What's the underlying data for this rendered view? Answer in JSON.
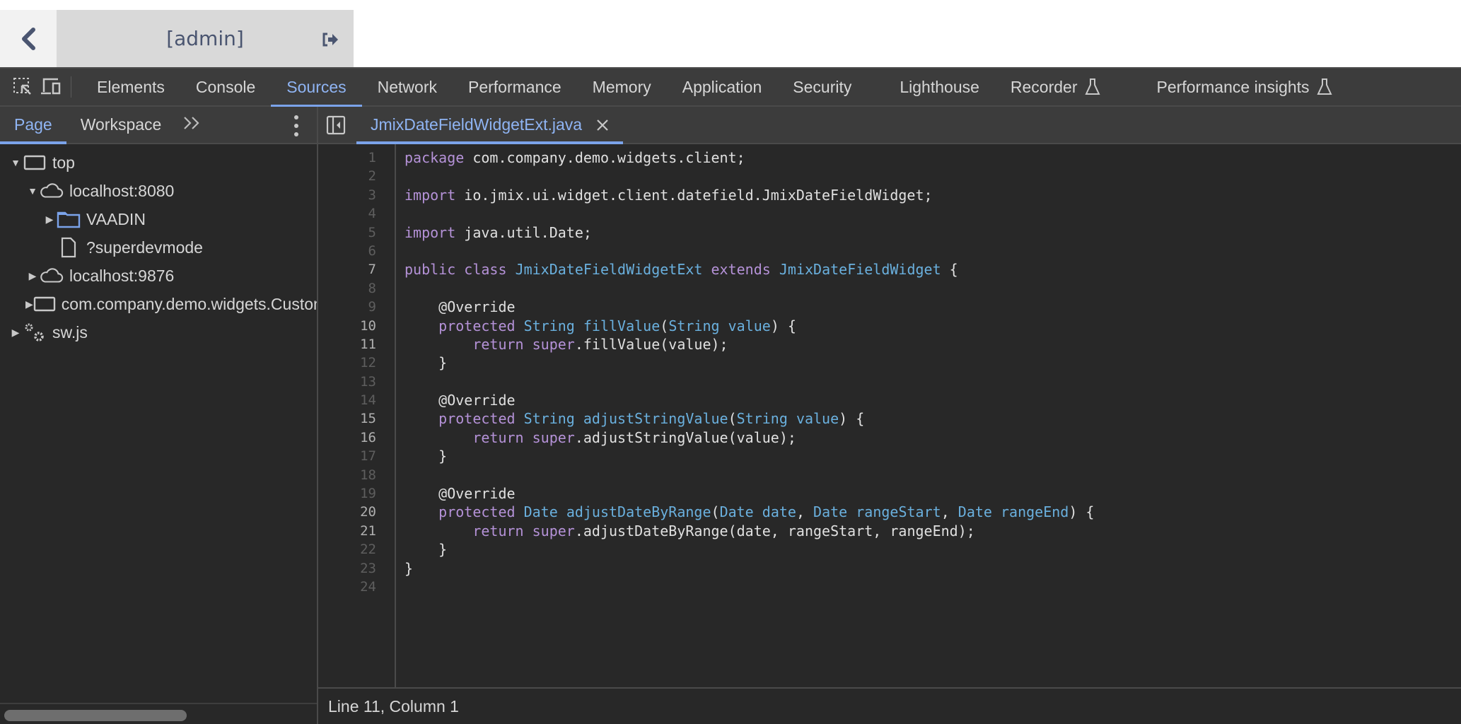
{
  "app_header": {
    "user_label": "[admin]"
  },
  "devtools": {
    "main_tabs": [
      {
        "label": "Elements"
      },
      {
        "label": "Console"
      },
      {
        "label": "Sources",
        "active": true
      },
      {
        "label": "Network"
      },
      {
        "label": "Performance"
      },
      {
        "label": "Memory"
      },
      {
        "label": "Application"
      },
      {
        "label": "Security"
      },
      {
        "label": "Lighthouse"
      },
      {
        "label": "Recorder",
        "experimental": true
      },
      {
        "label": "Performance insights",
        "experimental": true
      }
    ],
    "navigator": {
      "tabs": [
        {
          "label": "Page",
          "active": true
        },
        {
          "label": "Workspace"
        }
      ],
      "more_label": "»",
      "tree": [
        {
          "label": "top",
          "icon": "frame-icon",
          "arrow": "expanded",
          "depth": 0
        },
        {
          "label": "localhost:8080",
          "icon": "cloud-icon",
          "arrow": "expanded",
          "depth": 1
        },
        {
          "label": "VAADIN",
          "icon": "folder-icon",
          "arrow": "collapsed",
          "depth": 2
        },
        {
          "label": "?superdevmode",
          "icon": "file-icon",
          "arrow": "none",
          "depth": 2
        },
        {
          "label": "localhost:9876",
          "icon": "cloud-icon",
          "arrow": "collapsed",
          "depth": 1
        },
        {
          "label": "com.company.demo.widgets.CustomWidgetset",
          "icon": "frame-icon",
          "arrow": "collapsed",
          "depth": 1
        },
        {
          "label": "sw.js",
          "icon": "gears-icon",
          "arrow": "collapsed",
          "depth": 0
        }
      ]
    },
    "editor": {
      "open_file": "JmixDateFieldWidgetExt.java",
      "highlighted_lines": [
        7,
        10,
        11,
        15,
        16,
        20,
        21
      ],
      "code_lines": [
        [
          {
            "t": "package",
            "c": "kw"
          },
          {
            "t": " com.company.demo.widgets.client;"
          }
        ],
        [],
        [
          {
            "t": "import",
            "c": "kw"
          },
          {
            "t": " io.jmix.ui.widget.client.datefield.JmixDateFieldWidget;"
          }
        ],
        [],
        [
          {
            "t": "import",
            "c": "kw"
          },
          {
            "t": " java.util.Date;"
          }
        ],
        [],
        [
          {
            "t": "public",
            "c": "kw"
          },
          {
            "t": " "
          },
          {
            "t": "class",
            "c": "kw"
          },
          {
            "t": " "
          },
          {
            "t": "JmixDateFieldWidgetExt",
            "c": "ty"
          },
          {
            "t": " "
          },
          {
            "t": "extends",
            "c": "kw"
          },
          {
            "t": " "
          },
          {
            "t": "JmixDateFieldWidget",
            "c": "ty"
          },
          {
            "t": " {"
          }
        ],
        [],
        [
          {
            "t": "    @Override"
          }
        ],
        [
          {
            "t": "    "
          },
          {
            "t": "protected",
            "c": "kw"
          },
          {
            "t": " "
          },
          {
            "t": "String",
            "c": "ty"
          },
          {
            "t": " "
          },
          {
            "t": "fillValue",
            "c": "ty"
          },
          {
            "t": "("
          },
          {
            "t": "String",
            "c": "ty"
          },
          {
            "t": " "
          },
          {
            "t": "value",
            "c": "ty"
          },
          {
            "t": ") {"
          }
        ],
        [
          {
            "t": "        "
          },
          {
            "t": "return",
            "c": "kw"
          },
          {
            "t": " "
          },
          {
            "t": "super",
            "c": "kw"
          },
          {
            "t": ".fillValue(value);"
          }
        ],
        [
          {
            "t": "    }"
          }
        ],
        [],
        [
          {
            "t": "    @Override"
          }
        ],
        [
          {
            "t": "    "
          },
          {
            "t": "protected",
            "c": "kw"
          },
          {
            "t": " "
          },
          {
            "t": "String",
            "c": "ty"
          },
          {
            "t": " "
          },
          {
            "t": "adjustStringValue",
            "c": "ty"
          },
          {
            "t": "("
          },
          {
            "t": "String",
            "c": "ty"
          },
          {
            "t": " "
          },
          {
            "t": "value",
            "c": "ty"
          },
          {
            "t": ") {"
          }
        ],
        [
          {
            "t": "        "
          },
          {
            "t": "return",
            "c": "kw"
          },
          {
            "t": " "
          },
          {
            "t": "super",
            "c": "kw"
          },
          {
            "t": ".adjustStringValue(value);"
          }
        ],
        [
          {
            "t": "    }"
          }
        ],
        [],
        [
          {
            "t": "    @Override"
          }
        ],
        [
          {
            "t": "    "
          },
          {
            "t": "protected",
            "c": "kw"
          },
          {
            "t": " "
          },
          {
            "t": "Date",
            "c": "ty"
          },
          {
            "t": " "
          },
          {
            "t": "adjustDateByRange",
            "c": "ty"
          },
          {
            "t": "("
          },
          {
            "t": "Date",
            "c": "ty"
          },
          {
            "t": " "
          },
          {
            "t": "date",
            "c": "ty"
          },
          {
            "t": ", "
          },
          {
            "t": "Date",
            "c": "ty"
          },
          {
            "t": " "
          },
          {
            "t": "rangeStart",
            "c": "ty"
          },
          {
            "t": ", "
          },
          {
            "t": "Date",
            "c": "ty"
          },
          {
            "t": " "
          },
          {
            "t": "rangeEnd",
            "c": "ty"
          },
          {
            "t": ") {"
          }
        ],
        [
          {
            "t": "        "
          },
          {
            "t": "return",
            "c": "kw"
          },
          {
            "t": " "
          },
          {
            "t": "super",
            "c": "kw"
          },
          {
            "t": ".adjustDateByRange(date, rangeStart, rangeEnd);"
          }
        ],
        [
          {
            "t": "    }"
          }
        ],
        [
          {
            "t": "}"
          }
        ],
        []
      ]
    },
    "status": {
      "cursor_position": "Line 11, Column 1"
    },
    "colors": {
      "accent": "#7ba3ea",
      "active_text": "#8fb4f3",
      "keyword": "#b592d8",
      "type": "#6ab0de"
    }
  }
}
